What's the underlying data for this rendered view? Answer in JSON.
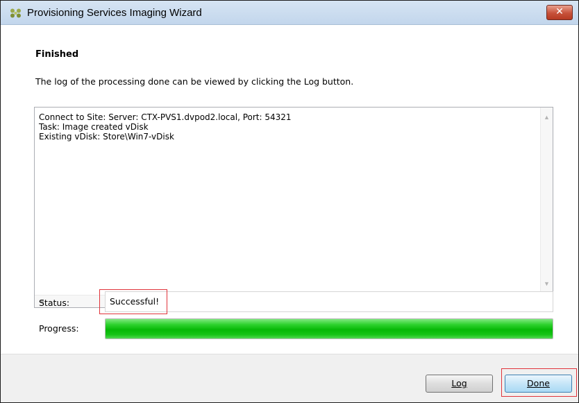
{
  "window": {
    "title": "Provisioning Services Imaging Wizard",
    "close_label": "✕"
  },
  "page": {
    "heading": "Finished",
    "description": "The log of the processing done can be viewed by clicking the Log button."
  },
  "log": {
    "lines": [
      "Connect to Site: Server: CTX-PVS1.dvpod2.local, Port: 54321",
      "Task: Image created vDisk",
      "Existing vDisk: Store\\Win7-vDisk"
    ]
  },
  "status": {
    "label": "Status:",
    "value": "Successful!"
  },
  "progress": {
    "label": "Progress:",
    "percent": 100
  },
  "buttons": {
    "log": "Log",
    "done": "Done"
  },
  "colors": {
    "highlight": "#e0333a",
    "progress": "#06b806"
  }
}
